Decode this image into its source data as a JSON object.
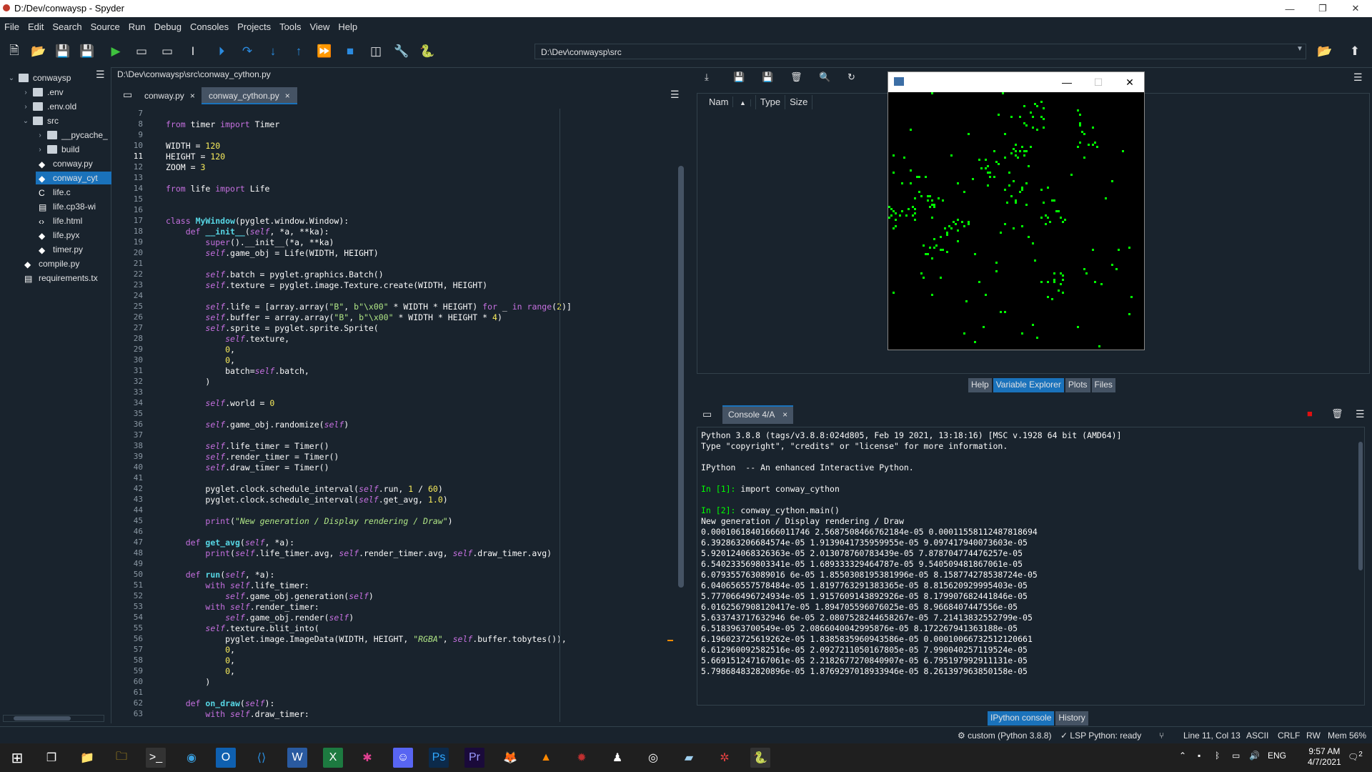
{
  "window": {
    "title": "D:/Dev/conwaysp - Spyder",
    "minimize": "—",
    "maximize": "❐",
    "close": "✕"
  },
  "menu": [
    "File",
    "Edit",
    "Search",
    "Source",
    "Run",
    "Debug",
    "Consoles",
    "Projects",
    "Tools",
    "View",
    "Help"
  ],
  "toolbar": {
    "working_dir": "D:\\Dev\\conwaysp\\src"
  },
  "explorer": {
    "items": [
      {
        "label": "conwaysp",
        "type": "folder",
        "depth": 0,
        "arrow": "⌄"
      },
      {
        "label": ".env",
        "type": "folder",
        "depth": 1,
        "arrow": "›"
      },
      {
        "label": ".env.old",
        "type": "folder",
        "depth": 1,
        "arrow": "›"
      },
      {
        "label": "src",
        "type": "folder",
        "depth": 1,
        "arrow": "⌄"
      },
      {
        "label": "__pycache_",
        "type": "folder",
        "depth": 2,
        "arrow": "›"
      },
      {
        "label": "build",
        "type": "folder",
        "depth": 2,
        "arrow": "›"
      },
      {
        "label": "conway.py",
        "type": "py",
        "depth": 2
      },
      {
        "label": "conway_cyt",
        "type": "py",
        "depth": 2,
        "selected": true
      },
      {
        "label": "life.c",
        "type": "c",
        "depth": 2
      },
      {
        "label": "life.cp38-wi",
        "type": "file",
        "depth": 2
      },
      {
        "label": "life.html",
        "type": "html",
        "depth": 2
      },
      {
        "label": "life.pyx",
        "type": "py",
        "depth": 2
      },
      {
        "label": "timer.py",
        "type": "py",
        "depth": 2
      },
      {
        "label": "compile.py",
        "type": "py",
        "depth": 1
      },
      {
        "label": "requirements.tx",
        "type": "file",
        "depth": 1
      }
    ]
  },
  "editor": {
    "path": "D:\\Dev\\conwaysp\\src\\conway_cython.py",
    "tabs": [
      {
        "label": "conway.py",
        "active": false
      },
      {
        "label": "conway_cython.py",
        "active": true
      }
    ],
    "tab_close": "×",
    "first_line": 7,
    "lines": [
      "",
      "<span class=\"kw\">from</span> timer <span class=\"kw\">import</span> Timer",
      "",
      "WIDTH = <span class=\"num\">120</span>",
      "HEIGHT = <span class=\"num\">120</span>",
      "ZOOM = <span class=\"num\">3</span>",
      "",
      "<span class=\"kw\">from</span> life <span class=\"kw\">import</span> Life",
      "",
      "",
      "<span class=\"kw\">class</span> <span class=\"fn\">MyWindow</span>(pyglet.window.Window):",
      "    <span class=\"kw\">def</span> <span class=\"fn\">__init__</span>(<span class=\"self\">self</span>, *a, **ka):",
      "        <span class=\"kw\">super</span>().__init__(*a, **ka)",
      "        <span class=\"self\">self</span>.game_obj = Life(WIDTH, HEIGHT)",
      "",
      "        <span class=\"self\">self</span>.batch = pyglet.graphics.Batch()",
      "        <span class=\"self\">self</span>.texture = pyglet.image.Texture.create(WIDTH, HEIGHT)",
      "",
      "        <span class=\"self\">self</span>.life = [array.array(<span class=\"str\">\"B\"</span>, <span class=\"str\">b\"\\x00\"</span> * WIDTH * HEIGHT) <span class=\"kw\">for</span> _ <span class=\"kw\">in</span> <span class=\"kw\">range</span>(<span class=\"num\">2</span>)]",
      "        <span class=\"self\">self</span>.buffer = array.array(<span class=\"str\">\"B\"</span>, <span class=\"str\">b\"\\x00\"</span> * WIDTH * HEIGHT * <span class=\"num\">4</span>)",
      "        <span class=\"self\">self</span>.sprite = pyglet.sprite.Sprite(",
      "            <span class=\"self\">self</span>.texture,",
      "            <span class=\"num\">0</span>,",
      "            <span class=\"num\">0</span>,",
      "            batch=<span class=\"self\">self</span>.batch,",
      "        )",
      "",
      "        <span class=\"self\">self</span>.world = <span class=\"num\">0</span>",
      "",
      "        <span class=\"self\">self</span>.game_obj.randomize(<span class=\"self\">self</span>)",
      "",
      "        <span class=\"self\">self</span>.life_timer = Timer()",
      "        <span class=\"self\">self</span>.render_timer = Timer()",
      "        <span class=\"self\">self</span>.draw_timer = Timer()",
      "",
      "        pyglet.clock.schedule_interval(<span class=\"self\">self</span>.run, <span class=\"num\">1</span> / <span class=\"num\">60</span>)",
      "        pyglet.clock.schedule_interval(<span class=\"self\">self</span>.get_avg, <span class=\"num\">1.0</span>)",
      "",
      "        <span class=\"kw\">print</span>(<span class=\"it\">\"New generation / Display rendering / Draw\"</span>)",
      "",
      "    <span class=\"kw\">def</span> <span class=\"fn\">get_avg</span>(<span class=\"self\">self</span>, *a):",
      "        <span class=\"kw\">print</span>(<span class=\"self\">self</span>.life_timer.avg, <span class=\"self\">self</span>.render_timer.avg, <span class=\"self\">self</span>.draw_timer.avg)",
      "",
      "    <span class=\"kw\">def</span> <span class=\"fn\">run</span>(<span class=\"self\">self</span>, *a):",
      "        <span class=\"kw\">with</span> <span class=\"self\">self</span>.life_timer:",
      "            <span class=\"self\">self</span>.game_obj.generation(<span class=\"self\">self</span>)",
      "        <span class=\"kw\">with</span> <span class=\"self\">self</span>.render_timer:",
      "            <span class=\"self\">self</span>.game_obj.render(<span class=\"self\">self</span>)",
      "        <span class=\"self\">self</span>.texture.blit_into(",
      "            pyglet.image.ImageData(WIDTH, HEIGHT, <span class=\"it\">\"RGBA\"</span>, <span class=\"self\">self</span>.buffer.tobytes()),",
      "            <span class=\"num\">0</span>,",
      "            <span class=\"num\">0</span>,",
      "            <span class=\"num\">0</span>,",
      "        )",
      "",
      "    <span class=\"kw\">def</span> <span class=\"fn\">on_draw</span>(<span class=\"self\">self</span>):",
      "        <span class=\"kw\">with</span> <span class=\"self\">self</span>.draw_timer:"
    ]
  },
  "variable_explorer": {
    "columns": [
      "Nam",
      "Type",
      "Size"
    ],
    "tabs": [
      {
        "label": "Help",
        "active": false
      },
      {
        "label": "Variable Explorer",
        "active": true
      },
      {
        "label": "Plots",
        "active": false
      },
      {
        "label": "Files",
        "active": false
      }
    ]
  },
  "console": {
    "tab_label": "Console 4/A",
    "tab_close": "×",
    "lines": [
      {
        "t": "Python 3.8.8 (tags/v3.8.8:024d805, Feb 19 2021, 13:18:16) [MSC v.1928 64 bit (AMD64)]"
      },
      {
        "t": "Type \"copyright\", \"credits\" or \"license\" for more information."
      },
      {
        "t": ""
      },
      {
        "t": "IPython  -- An enhanced Interactive Python."
      },
      {
        "t": ""
      },
      {
        "p": "In [1]: ",
        "t": "import conway_cython"
      },
      {
        "t": ""
      },
      {
        "p": "In [2]: ",
        "t": "conway_cython.main()"
      },
      {
        "t": "New generation / Display rendering / Draw"
      },
      {
        "t": "0.00010618401666011746 2.5687508466762184e-05 0.00011558112487818694"
      },
      {
        "t": "6.392863206684574e-05 1.9139041735959955e-05 9.097417940073603e-05"
      },
      {
        "t": "5.920124068326363e-05 2.013078760783439e-05 7.878704774476257e-05"
      },
      {
        "t": "6.540233569803341e-05 1.689333329464787e-05 9.540509481867061e-05"
      },
      {
        "t": "6.079355763089016 6e-05 1.8550308195381996e-05 8.158774278538724e-05"
      },
      {
        "t": "6.040656557578484e-05 1.8197763291383365e-05 8.815620929995403e-05"
      },
      {
        "t": "5.777066496724934e-05 1.9157609143892926e-05 8.179907682441846e-05"
      },
      {
        "t": "6.0162567908120417e-05 1.894705596076025e-05 8.9668407447556e-05"
      },
      {
        "t": "5.633743717632946 6e-05 2.0807528244658267e-05 7.21413832552799e-05"
      },
      {
        "t": "6.5183963700549e-05 2.0866040042995876e-05 8.172267941363188e-05"
      },
      {
        "t": "6.196023725619262e-05 1.8385835960943586e-05 0.00010066732512120661"
      },
      {
        "t": "6.612960092582516e-05 2.0927211050167805e-05 7.990040257119524e-05"
      },
      {
        "t": "5.669151247167061e-05 2.2182677270840907e-05 6.795197992911131e-05"
      },
      {
        "t": "5.798684832820896e-05 1.8769297018933946e-05 8.261397963850158e-05"
      }
    ],
    "tabs": [
      {
        "label": "IPython console",
        "active": true
      },
      {
        "label": "History",
        "active": false
      }
    ]
  },
  "statusbar": {
    "env": "custom (Python 3.8.8)",
    "lsp": "LSP Python: ready",
    "position": "Line 11, Col 13",
    "encoding": "ASCII",
    "eol": "CRLF",
    "rw": "RW",
    "mem": "Mem 56%"
  },
  "taskbar": {
    "time": "9:57 AM",
    "date": "4/7/2021",
    "lang": "ENG",
    "notif_count": "2"
  },
  "colors": {
    "accent": "#1a72bb",
    "bg": "#19232d",
    "green_cells": "#00ff00"
  }
}
